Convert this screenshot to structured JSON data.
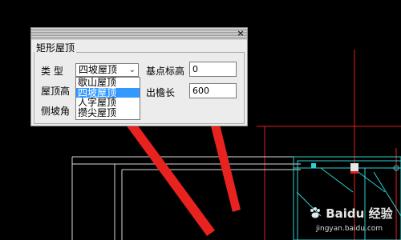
{
  "dialog": {
    "group_title": "矩形屋顶",
    "close_glyph": "×",
    "type_label": "类    型",
    "type_value": "四坡屋顶",
    "type_options": [
      "歇山屋顶",
      "四坡屋顶",
      "人字屋顶",
      "攒尖屋顶"
    ],
    "selected_option_index": 1,
    "base_elevation_label": "基点标高",
    "base_elevation_value": "0",
    "roof_height_label": "屋顶高",
    "overhang_label": "出檐长",
    "overhang_value": "600",
    "side_slope_label": "侧坡角"
  },
  "watermark": {
    "brand_text": "Baidu 经验",
    "url": "jingyan.baidu.com"
  },
  "colors": {
    "background": "#000000",
    "arrow": "#e8231f",
    "cad_red_lines": "#e02020",
    "cad_cyan_lines": "#2fd0d0",
    "cad_white_lines": "#d8d8d8",
    "selection": "#3399ff"
  }
}
